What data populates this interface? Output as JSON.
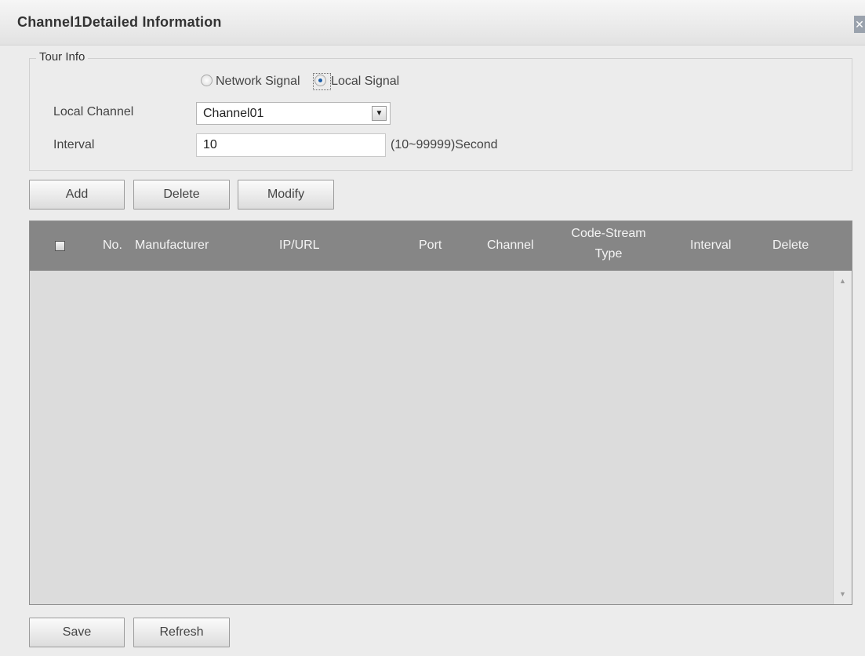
{
  "window": {
    "title": "Channel1Detailed Information",
    "close_glyph": "✕"
  },
  "tour_info": {
    "legend": "Tour Info",
    "signal_options": [
      {
        "label": "Network Signal",
        "checked": false
      },
      {
        "label": "Local Signal",
        "checked": true
      }
    ],
    "local_channel_label": "Local Channel",
    "local_channel_value": "Channel01",
    "dropdown_arrow": "▼",
    "interval_label": "Interval",
    "interval_value": "10",
    "interval_hint": "(10~99999)Second"
  },
  "actions": {
    "add": "Add",
    "delete": "Delete",
    "modify": "Modify"
  },
  "table": {
    "columns": {
      "no": "No.",
      "manufacturer": "Manufacturer",
      "ip_url": "IP/URL",
      "port": "Port",
      "channel": "Channel",
      "code_stream_line1": "Code-Stream",
      "code_stream_line2": "Type",
      "interval": "Interval",
      "delete": "Delete"
    },
    "rows": [],
    "scroll_up": "▲",
    "scroll_down": "▼"
  },
  "footer": {
    "save": "Save",
    "refresh": "Refresh"
  },
  "colors": {
    "header_bg": "#868686",
    "dialog_bg": "#ececec",
    "table_body_bg": "#dcdcdc"
  }
}
